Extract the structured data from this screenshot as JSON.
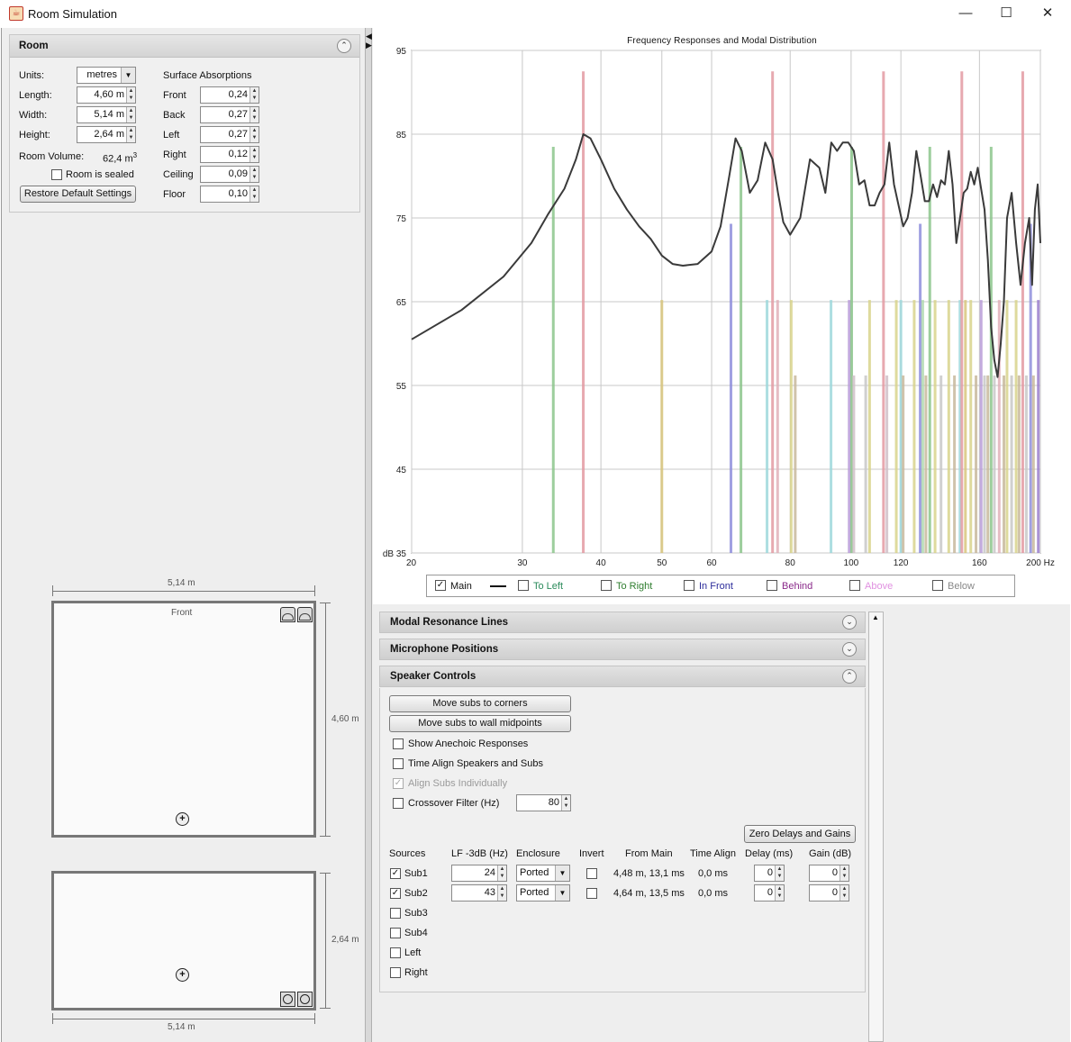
{
  "window": {
    "title": "Room Simulation",
    "minimize": "—",
    "maximize": "☐",
    "close": "✕"
  },
  "room_panel": {
    "header": "Room",
    "units_label": "Units:",
    "units_value": "metres",
    "length_label": "Length:",
    "length_value": "4,60 m",
    "width_label": "Width:",
    "width_value": "5,14 m",
    "height_label": "Height:",
    "height_value": "2,64 m",
    "volume_label": "Room Volume:",
    "volume_value": "62,4 m",
    "volume_sup": "3",
    "sealed_label": "Room is sealed",
    "sealed_checked": false,
    "restore_button": "Restore Default Settings",
    "absorption_title": "Surface Absorptions",
    "absorptions": [
      {
        "label": "Front",
        "value": "0,24"
      },
      {
        "label": "Back",
        "value": "0,27"
      },
      {
        "label": "Left",
        "value": "0,27"
      },
      {
        "label": "Right",
        "value": "0,12"
      },
      {
        "label": "Ceiling",
        "value": "0,09"
      },
      {
        "label": "Floor",
        "value": "0,10"
      }
    ]
  },
  "plan_top": {
    "width_label": "5,14 m",
    "depth_label": "4,60 m",
    "front_label": "Front"
  },
  "plan_side": {
    "height_label": "2,64 m",
    "width_label": "5,14 m"
  },
  "chart_data": {
    "type": "line",
    "title": "Frequency Responses and Modal Distribution",
    "x_scale": "log",
    "xlim": [
      20,
      200
    ],
    "ylim": [
      35,
      95
    ],
    "x_ticks": [
      "20",
      "30",
      "40",
      "50",
      "60",
      "80",
      "100",
      "120",
      "160",
      "200 Hz"
    ],
    "x_tick_values": [
      20,
      30,
      40,
      50,
      60,
      80,
      100,
      120,
      160,
      200
    ],
    "y_ticks": [
      "dB 35",
      "45",
      "55",
      "65",
      "75",
      "85",
      "95"
    ],
    "y_tick_values": [
      35,
      45,
      55,
      65,
      75,
      85,
      95
    ],
    "series": [
      {
        "name": "Main",
        "color": "#3a3a3a",
        "x": [
          20,
          24,
          28,
          31,
          33,
          35,
          36.5,
          37.5,
          38.5,
          40,
          42,
          44,
          46,
          48,
          50,
          52,
          54,
          57,
          60,
          62,
          64,
          65.5,
          67,
          69,
          71,
          73,
          75,
          76.5,
          78,
          80,
          83,
          86,
          89,
          91,
          93,
          95,
          97,
          99,
          101,
          103,
          105,
          107,
          109,
          111,
          113,
          115,
          117,
          119,
          121,
          123,
          125,
          127,
          129,
          131,
          133,
          135,
          137,
          139,
          141,
          143,
          145,
          147,
          149,
          151,
          153,
          155,
          157,
          159,
          161,
          163,
          165,
          167,
          169,
          171,
          173,
          175,
          177,
          180,
          183,
          186,
          189,
          192,
          194,
          196,
          198,
          200
        ],
        "values": [
          60.5,
          64,
          68,
          72,
          75.5,
          78.5,
          82,
          85,
          84.5,
          82,
          78.5,
          76,
          74,
          72.5,
          70.5,
          69.5,
          69.3,
          69.5,
          71,
          74,
          80,
          84.5,
          83,
          78,
          79.5,
          84,
          82,
          78,
          74.5,
          73,
          75,
          82,
          81,
          78,
          84,
          83,
          84,
          84,
          83,
          79,
          79.5,
          76.5,
          76.5,
          78,
          79,
          84,
          79,
          76.5,
          74,
          75,
          78,
          83,
          80,
          77,
          77,
          79,
          77.5,
          79.5,
          79,
          83,
          79,
          72,
          75,
          78,
          78.5,
          80.5,
          79,
          81,
          78.5,
          76,
          70,
          62,
          58,
          56,
          60,
          65,
          75,
          78,
          72,
          67,
          72,
          75,
          67,
          76,
          79,
          72
        ]
      }
    ],
    "modal_lines": [
      {
        "f": 33.6,
        "db": 83.5,
        "color": "#8cc58c"
      },
      {
        "f": 37.5,
        "db": 92.5,
        "color": "#e39aa2"
      },
      {
        "f": 50.0,
        "db": 65.2,
        "color": "#d8c57c"
      },
      {
        "f": 64.4,
        "db": 74.3,
        "color": "#8f8fdc"
      },
      {
        "f": 66.8,
        "db": 83.5,
        "color": "#8cc58c"
      },
      {
        "f": 73.5,
        "db": 65.2,
        "color": "#9fd8dc"
      },
      {
        "f": 75.0,
        "db": 92.5,
        "color": "#e39aa2"
      },
      {
        "f": 76.4,
        "db": 65.2,
        "color": "#e0b0b8"
      },
      {
        "f": 80.3,
        "db": 65.2,
        "color": "#d8d48c"
      },
      {
        "f": 81.5,
        "db": 56.2,
        "color": "#c8b89c"
      },
      {
        "f": 92.9,
        "db": 65.2,
        "color": "#9fd8dc"
      },
      {
        "f": 99.3,
        "db": 65.2,
        "color": "#b89cd8"
      },
      {
        "f": 100.2,
        "db": 83.5,
        "color": "#8cc58c"
      },
      {
        "f": 101.0,
        "db": 56.2,
        "color": "#d0c0c8"
      },
      {
        "f": 105.5,
        "db": 56.2,
        "color": "#c8c8c8"
      },
      {
        "f": 107.0,
        "db": 65.2,
        "color": "#d8d48c"
      },
      {
        "f": 112.6,
        "db": 92.5,
        "color": "#e39aa2"
      },
      {
        "f": 114.0,
        "db": 56.2,
        "color": "#d0c0c8"
      },
      {
        "f": 118.0,
        "db": 65.2,
        "color": "#d8d48c"
      },
      {
        "f": 120.0,
        "db": 65.2,
        "color": "#9fd8dc"
      },
      {
        "f": 121.0,
        "db": 56.2,
        "color": "#c8b89c"
      },
      {
        "f": 126.0,
        "db": 65.2,
        "color": "#d8d48c"
      },
      {
        "f": 128.8,
        "db": 74.3,
        "color": "#8f8fdc"
      },
      {
        "f": 130.0,
        "db": 65.2,
        "color": "#b0d8b0"
      },
      {
        "f": 131.5,
        "db": 56.2,
        "color": "#c8b89c"
      },
      {
        "f": 133.4,
        "db": 83.5,
        "color": "#8cc58c"
      },
      {
        "f": 136.0,
        "db": 65.2,
        "color": "#d8d48c"
      },
      {
        "f": 139.0,
        "db": 56.2,
        "color": "#c8c8c8"
      },
      {
        "f": 143.0,
        "db": 65.2,
        "color": "#d8d48c"
      },
      {
        "f": 146.0,
        "db": 56.2,
        "color": "#c8b89c"
      },
      {
        "f": 149.0,
        "db": 65.2,
        "color": "#9fd8dc"
      },
      {
        "f": 150.0,
        "db": 92.5,
        "color": "#e39aa2"
      },
      {
        "f": 152.0,
        "db": 65.2,
        "color": "#d8c57c"
      },
      {
        "f": 155.0,
        "db": 65.2,
        "color": "#d8d48c"
      },
      {
        "f": 158.0,
        "db": 56.2,
        "color": "#c8b89c"
      },
      {
        "f": 161.0,
        "db": 65.2,
        "color": "#b89cd8"
      },
      {
        "f": 163.0,
        "db": 56.2,
        "color": "#c8c8c8"
      },
      {
        "f": 165.0,
        "db": 56.2,
        "color": "#c8b89c"
      },
      {
        "f": 167.0,
        "db": 83.5,
        "color": "#8cc58c"
      },
      {
        "f": 169.0,
        "db": 56.2,
        "color": "#c8c8c8"
      },
      {
        "f": 172.0,
        "db": 65.2,
        "color": "#e0b0b8"
      },
      {
        "f": 175.0,
        "db": 56.2,
        "color": "#c8b89c"
      },
      {
        "f": 177.0,
        "db": 65.2,
        "color": "#d8d48c"
      },
      {
        "f": 180.0,
        "db": 56.2,
        "color": "#c8c8c8"
      },
      {
        "f": 183.0,
        "db": 65.2,
        "color": "#d8d48c"
      },
      {
        "f": 185.0,
        "db": 56.2,
        "color": "#c8b89c"
      },
      {
        "f": 187.5,
        "db": 92.5,
        "color": "#e39aa2"
      },
      {
        "f": 190.0,
        "db": 56.2,
        "color": "#c8c8c8"
      },
      {
        "f": 193.0,
        "db": 74.3,
        "color": "#8f8fdc"
      },
      {
        "f": 195.0,
        "db": 56.2,
        "color": "#c8b89c"
      },
      {
        "f": 198.5,
        "db": 65.2,
        "color": "#9b7fcc"
      }
    ],
    "grid": true
  },
  "legend": [
    {
      "label": "Main",
      "checked": true,
      "color": "#111111"
    },
    {
      "label": "To Left",
      "checked": false,
      "color": "#2a8a5a"
    },
    {
      "label": "To Right",
      "checked": false,
      "color": "#2f7d2f"
    },
    {
      "label": "In Front",
      "checked": false,
      "color": "#2b2b9a"
    },
    {
      "label": "Behind",
      "checked": false,
      "color": "#8a2a8a"
    },
    {
      "label": "Above",
      "checked": false,
      "color": "#e090e0"
    },
    {
      "label": "Below",
      "checked": false,
      "color": "#888888"
    }
  ],
  "accordion": {
    "modal": "Modal Resonance Lines",
    "mic": "Microphone Positions",
    "speaker": "Speaker Controls"
  },
  "speaker_controls": {
    "move_corners": "Move subs to corners",
    "move_midpoints": "Move subs to wall midpoints",
    "show_anechoic": "Show Anechoic Responses",
    "time_align": "Time Align Speakers and Subs",
    "align_individually": "Align Subs Individually",
    "crossover_label": "Crossover Filter (Hz)",
    "crossover_value": "80",
    "zero_button": "Zero Delays and Gains",
    "columns": [
      "Sources",
      "LF -3dB (Hz)",
      "Enclosure",
      "Invert",
      "From Main",
      "Time Align",
      "Delay (ms)",
      "Gain (dB)"
    ],
    "sources": [
      {
        "name": "Sub1",
        "checked": true,
        "lf": "24",
        "enclosure": "Ported",
        "from_main": "4,48 m, 13,1 ms",
        "time_align": "0,0 ms",
        "delay": "0",
        "gain": "0"
      },
      {
        "name": "Sub2",
        "checked": true,
        "lf": "43",
        "enclosure": "Ported",
        "from_main": "4,64 m, 13,5 ms",
        "time_align": "0,0 ms",
        "delay": "0",
        "gain": "0"
      },
      {
        "name": "Sub3",
        "checked": false
      },
      {
        "name": "Sub4",
        "checked": false
      },
      {
        "name": "Left",
        "checked": false
      },
      {
        "name": "Right",
        "checked": false
      }
    ]
  }
}
